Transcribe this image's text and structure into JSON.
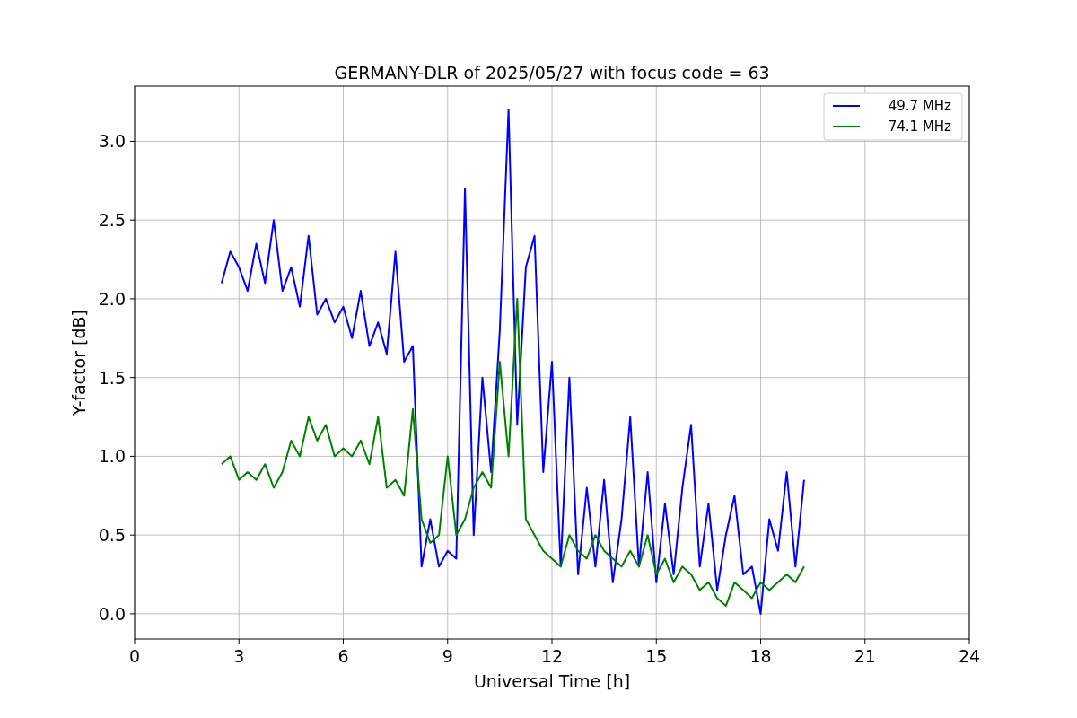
{
  "figure": {
    "chart_data": {
      "type": "line",
      "title": "GERMANY-DLR of 2025/05/27 with focus code = 63",
      "xlabel": "Universal Time [h]",
      "ylabel": "Y-factor [dB]",
      "x": [
        2.5,
        2.75,
        3,
        3.25,
        3.5,
        3.75,
        4,
        4.25,
        4.5,
        4.75,
        5,
        5.25,
        5.5,
        5.75,
        6,
        6.25,
        6.5,
        6.75,
        7,
        7.25,
        7.5,
        7.75,
        8,
        8.25,
        8.5,
        8.75,
        9,
        9.25,
        9.5,
        9.75,
        10,
        10.25,
        10.5,
        10.75,
        11,
        11.25,
        11.5,
        11.75,
        12,
        12.25,
        12.5,
        12.75,
        13,
        13.25,
        13.5,
        13.75,
        14,
        14.25,
        14.5,
        14.75,
        15,
        15.25,
        15.5,
        15.75,
        16,
        16.25,
        16.5,
        16.75,
        17,
        17.25,
        17.5,
        17.75,
        18,
        18.25,
        18.5,
        18.75,
        19,
        19.25
      ],
      "series": [
        {
          "name": "49.7 MHz",
          "color": "#0000ff",
          "values": [
            2.1,
            2.3,
            2.2,
            2.05,
            2.35,
            2.1,
            2.5,
            2.05,
            2.2,
            1.95,
            2.4,
            1.9,
            2.0,
            1.85,
            1.95,
            1.75,
            2.05,
            1.7,
            1.85,
            1.65,
            2.3,
            1.6,
            1.7,
            0.3,
            0.6,
            0.3,
            0.4,
            0.35,
            2.7,
            0.5,
            1.5,
            0.9,
            1.8,
            3.2,
            1.2,
            2.2,
            2.4,
            0.9,
            1.6,
            0.3,
            1.5,
            0.25,
            0.8,
            0.3,
            0.85,
            0.2,
            0.6,
            1.25,
            0.3,
            0.9,
            0.2,
            0.7,
            0.25,
            0.8,
            1.2,
            0.3,
            0.7,
            0.15,
            0.5,
            0.75,
            0.25,
            0.3,
            0.0,
            0.6,
            0.4,
            0.9,
            0.3,
            0.85
          ]
        },
        {
          "name": "74.1 MHz",
          "color": "#008000",
          "values": [
            0.95,
            1.0,
            0.85,
            0.9,
            0.85,
            0.95,
            0.8,
            0.9,
            1.1,
            1.0,
            1.25,
            1.1,
            1.2,
            1.0,
            1.05,
            1.0,
            1.1,
            0.95,
            1.25,
            0.8,
            0.85,
            0.75,
            1.3,
            0.6,
            0.45,
            0.5,
            1.0,
            0.5,
            0.6,
            0.8,
            0.9,
            0.8,
            1.6,
            1.0,
            2.0,
            0.6,
            0.5,
            0.4,
            0.35,
            0.3,
            0.5,
            0.4,
            0.35,
            0.5,
            0.4,
            0.35,
            0.3,
            0.4,
            0.3,
            0.5,
            0.25,
            0.35,
            0.2,
            0.3,
            0.25,
            0.15,
            0.2,
            0.1,
            0.05,
            0.2,
            0.15,
            0.1,
            0.2,
            0.15,
            0.2,
            0.25,
            0.2,
            0.3
          ]
        }
      ],
      "grid": true,
      "legend": true,
      "xlim": [
        0,
        24
      ],
      "ylim": [
        -0.16,
        3.35
      ],
      "xticks": [
        0,
        3,
        6,
        9,
        12,
        15,
        18,
        21,
        24
      ],
      "yticks": [
        {
          "value": 0,
          "label": "0.0"
        },
        {
          "value": 0.5,
          "label": "0.5"
        },
        {
          "value": 1,
          "label": "1.0"
        },
        {
          "value": 1.5,
          "label": "1.5"
        },
        {
          "value": 2,
          "label": "2.0"
        },
        {
          "value": 2.5,
          "label": "2.5"
        },
        {
          "value": 3,
          "label": "3.0"
        }
      ]
    }
  }
}
